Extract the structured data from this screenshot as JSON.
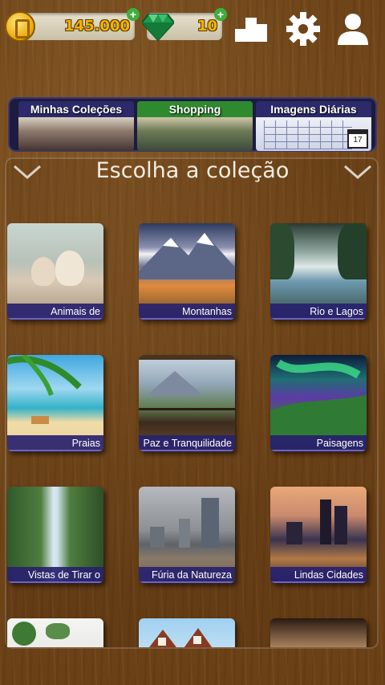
{
  "header": {
    "coins": "145.000",
    "gems": "10",
    "plus_symbol": "+",
    "icons": [
      "coin-icon",
      "gem-icon",
      "leaderboard-icon",
      "gear-icon",
      "user-icon"
    ]
  },
  "menu": {
    "items": [
      {
        "label": "Minhas Coleções"
      },
      {
        "label": "Shopping"
      },
      {
        "label": "Imagens Diárias",
        "calendar_day": "17"
      }
    ]
  },
  "collection": {
    "title": "Escolha a coleção",
    "cards": [
      {
        "label": "Animais de"
      },
      {
        "label": "Montanhas"
      },
      {
        "label": "Rio e Lagos"
      },
      {
        "label": "Praias"
      },
      {
        "label": "Paz e Tranquilidade"
      },
      {
        "label": "Paisagens"
      },
      {
        "label": "Vistas de Tirar o"
      },
      {
        "label": "Fúria da Natureza"
      },
      {
        "label": "Lindas Cidades"
      },
      {
        "label": ""
      },
      {
        "label": ""
      },
      {
        "label": ""
      }
    ]
  },
  "colors": {
    "wood": "#6e4418",
    "label_bar": "#28226e",
    "coin_text": "#f2b400",
    "shopping_green": "#2f8a2f"
  }
}
